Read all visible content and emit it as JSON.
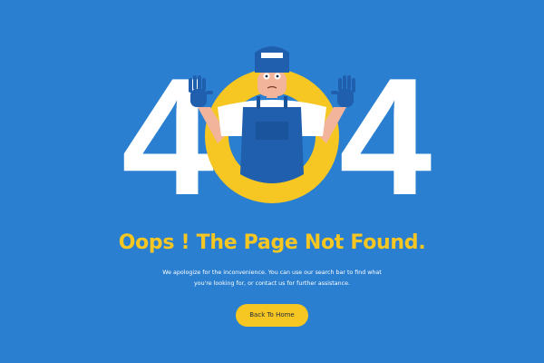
{
  "hero": {
    "digit_left": "4",
    "digit_right": "4"
  },
  "headline": "Oops ! The Page Not Found.",
  "message": "We apologize for the inconvenience. You can use our search bar to find what you're looking for, or contact us for further assistance.",
  "button": {
    "label": "Back To Home"
  },
  "colors": {
    "background": "#2a7fd0",
    "accent": "#f6c623",
    "text": "#ffffff"
  }
}
